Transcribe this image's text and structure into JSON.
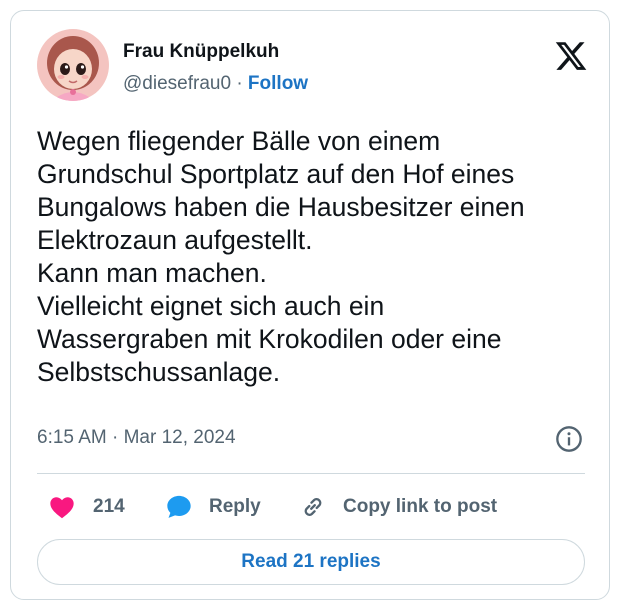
{
  "author": {
    "name": "Frau Knüppelkuh",
    "handle": "@diesefrau0",
    "separator": "·",
    "follow_label": "Follow"
  },
  "tweet": {
    "lines": [
      "Wegen fliegender Bälle von einem",
      "Grundschul Sportplatz auf den Hof eines",
      "Bungalows haben die Hausbesitzer einen",
      "Elektrozaun aufgestellt.",
      "Kann man machen.",
      "Vielleicht eignet sich auch ein",
      "Wassergraben mit Krokodilen oder eine",
      "Selbstschussanlage."
    ],
    "timestamp": "6:15 AM · Mar 12, 2024"
  },
  "actions": {
    "like_count": "214",
    "reply_label": "Reply",
    "copy_label": "Copy link to post"
  },
  "replies_button": "Read 21 replies",
  "colors": {
    "accent": "#1d74c4",
    "like": "#f91880",
    "text": "#0f1419",
    "muted": "#536471",
    "border": "#cfd9de"
  },
  "icons": [
    "avatar-image",
    "x-logo-icon",
    "info-icon",
    "heart-icon",
    "reply-bubble-icon",
    "link-icon"
  ]
}
